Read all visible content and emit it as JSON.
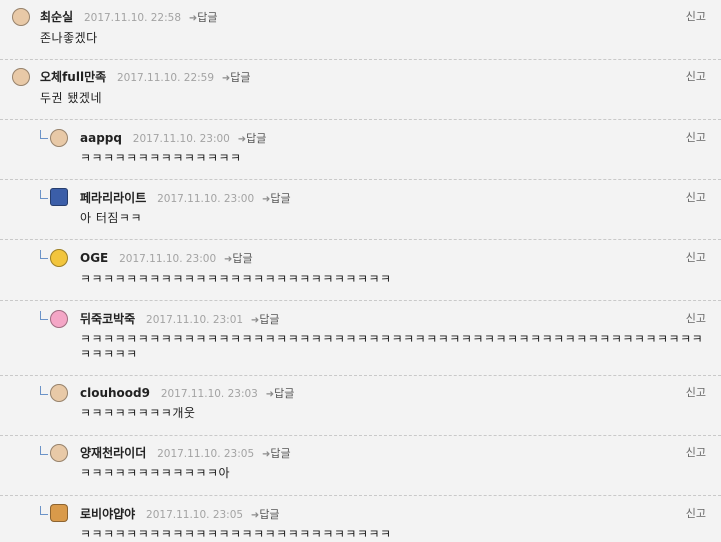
{
  "reply_label": "답글",
  "report_label": "신고",
  "comments": [
    {
      "nick": "최순실",
      "date": "2017.11.10. 22:58",
      "text": "존나좋겠다",
      "avatar": "old-man-glasses-avatar",
      "avatar_color": "#e8c9a7"
    },
    {
      "nick": "오체full만족",
      "date": "2017.11.10. 22:59",
      "text": "두권 됐겠네",
      "avatar": "old-man-glasses-avatar",
      "avatar_color": "#e8c9a7"
    },
    {
      "nick": "aappq",
      "date": "2017.11.10. 23:00",
      "text": "ㅋㅋㅋㅋㅋㅋㅋㅋㅋㅋㅋㅋㅋㅋ",
      "avatar": "old-man-glasses-avatar",
      "avatar_color": "#e8c9a7"
    },
    {
      "nick": "페라리라이트",
      "date": "2017.11.10. 23:00",
      "text": "아 터짐ㅋㅋ",
      "avatar": "figure-avatar",
      "avatar_color": "#3b5ea8"
    },
    {
      "nick": "OGE",
      "date": "2017.11.10. 23:00",
      "text": "ㅋㅋㅋㅋㅋㅋㅋㅋㅋㅋㅋㅋㅋㅋㅋㅋㅋㅋㅋㅋㅋㅋㅋㅋㅋㅋㅋ",
      "avatar": "yellow-face-avatar",
      "avatar_color": "#f2c53d"
    },
    {
      "nick": "뒤죽코박죽",
      "date": "2017.11.10. 23:01",
      "text": "ㅋㅋㅋㅋㅋㅋㅋㅋㅋㅋㅋㅋㅋㅋㅋㅋㅋㅋㅋㅋㅋㅋㅋㅋㅋㅋㅋㅋㅋㅋㅋㅋㅋㅋㅋㅋㅋㅋㅋㅋㅋㅋㅋㅋㅋㅋㅋㅋㅋㅋㅋㅋㅋㅋㅋㅋㅋㅋㅋ",
      "avatar": "pink-face-avatar",
      "avatar_color": "#f4a6c6"
    },
    {
      "nick": "clouhood9",
      "date": "2017.11.10. 23:03",
      "text": "ㅋㅋㅋㅋㅋㅋㅋㅋ개웃",
      "avatar": "old-man-glasses-avatar",
      "avatar_color": "#e8c9a7"
    },
    {
      "nick": "양재천라이더",
      "date": "2017.11.10. 23:05",
      "text": "ㅋㅋㅋㅋㅋㅋㅋㅋㅋㅋㅋㅋ아",
      "avatar": "old-man-glasses-avatar",
      "avatar_color": "#e8c9a7"
    },
    {
      "nick": "로비야얍야",
      "date": "2017.11.10. 23:05",
      "text": "ㅋㅋㅋㅋㅋㅋㅋㅋㅋㅋㅋㅋㅋㅋㅋㅋㅋㅋㅋㅋㅋㅋㅋㅋㅋㅋㅋ",
      "avatar": "dog-avatar",
      "avatar_color": "#d99a4a"
    }
  ]
}
